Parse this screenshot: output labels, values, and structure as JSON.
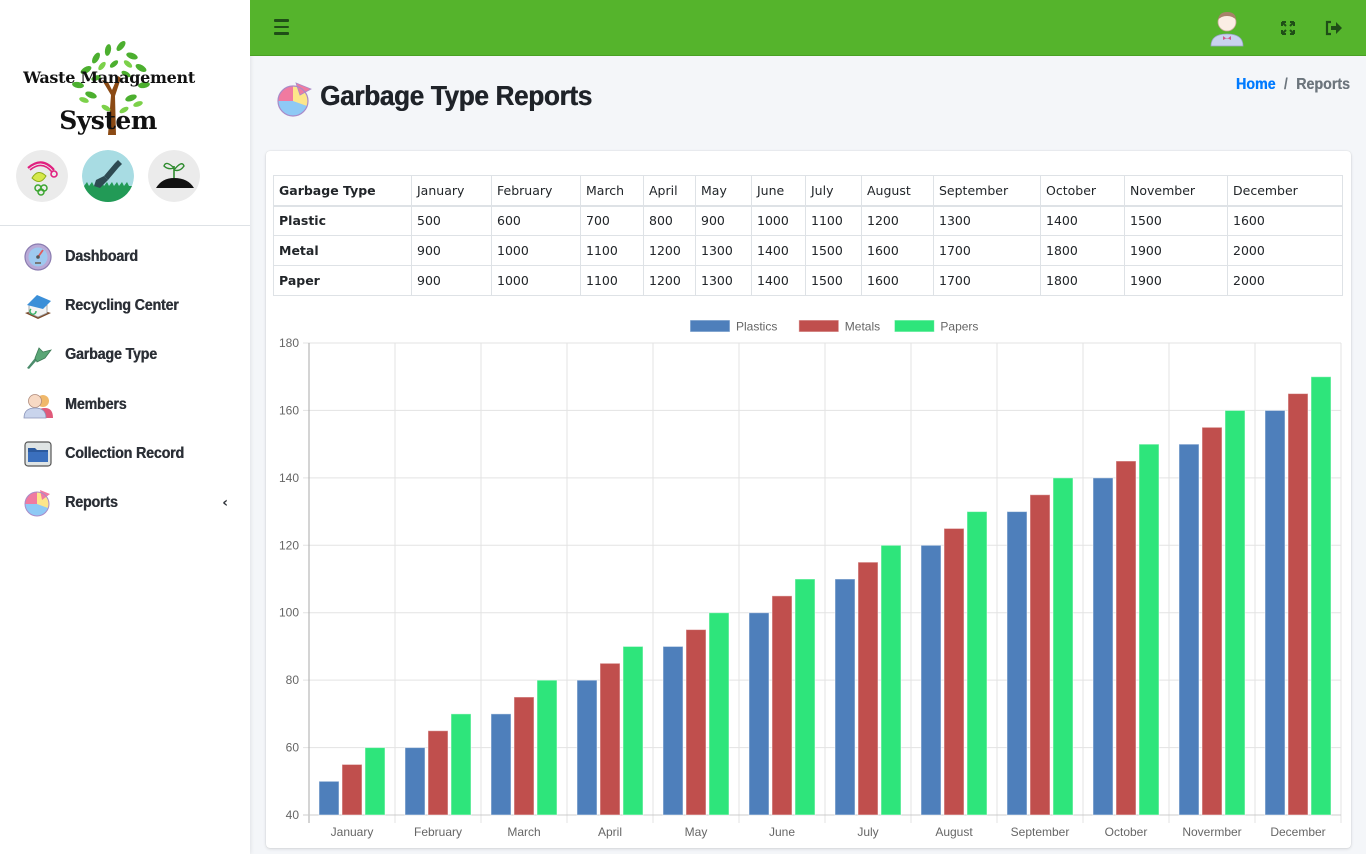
{
  "app": {
    "brand_line1": "Waste Management",
    "brand_line2": "System",
    "brand_badges": [
      "recycle-leaf-badge",
      "shovel-badge",
      "sprout-soil-badge"
    ]
  },
  "sidebar": {
    "items": [
      {
        "label": "Dashboard",
        "icon": "dashboard-gauge-icon"
      },
      {
        "label": "Recycling Center",
        "icon": "recycling-center-icon"
      },
      {
        "label": "Garbage Type",
        "icon": "garbage-type-icon"
      },
      {
        "label": "Members",
        "icon": "members-icon"
      },
      {
        "label": "Collection Record",
        "icon": "folder-icon"
      },
      {
        "label": "Reports",
        "icon": "pie-chart-icon",
        "arrow": "‹"
      }
    ]
  },
  "topbar": {
    "menu_icon": "hamburger-icon",
    "avatar_icon": "user-avatar-icon",
    "fullscreen_icon": "expand-icon",
    "logout_icon": "sign-out-icon",
    "bg_color": "#55b42c"
  },
  "header": {
    "title": "Garbage Type Reports",
    "breadcrumb": {
      "home": "Home",
      "separator": "/",
      "current": "Reports"
    }
  },
  "table": {
    "headers": [
      "Garbage Type",
      "January",
      "February",
      "March",
      "April",
      "May",
      "June",
      "July",
      "August",
      "September",
      "October",
      "November",
      "December"
    ],
    "rows": [
      {
        "type": "Plastic",
        "values": [
          "500",
          "600",
          "700",
          "800",
          "900",
          "1000",
          "1100",
          "1200",
          "1300",
          "1400",
          "1500",
          "1600"
        ]
      },
      {
        "type": "Metal",
        "values": [
          "900",
          "1000",
          "1100",
          "1200",
          "1300",
          "1400",
          "1500",
          "1600",
          "1700",
          "1800",
          "1900",
          "2000"
        ]
      },
      {
        "type": "Paper",
        "values": [
          "900",
          "1000",
          "1100",
          "1200",
          "1300",
          "1400",
          "1500",
          "1600",
          "1700",
          "1800",
          "1900",
          "2000"
        ]
      }
    ]
  },
  "chart_data": {
    "type": "bar",
    "title": "",
    "xlabel": "",
    "ylabel": "",
    "categories": [
      "January",
      "February",
      "March",
      "April",
      "May",
      "June",
      "July",
      "August",
      "September",
      "October",
      "Novermber",
      "December"
    ],
    "series": [
      {
        "name": "Plastics",
        "color": "#4e7fbb",
        "values": [
          50,
          60,
          70,
          80,
          90,
          100,
          110,
          120,
          130,
          140,
          150,
          160
        ]
      },
      {
        "name": "Metals",
        "color": "#c04f4d",
        "values": [
          55,
          65,
          75,
          85,
          95,
          105,
          115,
          125,
          135,
          145,
          155,
          165
        ]
      },
      {
        "name": "Papers",
        "color": "#2ee57b",
        "values": [
          60,
          70,
          80,
          90,
          100,
          110,
          120,
          130,
          140,
          150,
          160,
          170
        ]
      }
    ],
    "ylim": [
      40,
      180
    ],
    "yticks": [
      40,
      60,
      80,
      100,
      120,
      140,
      160,
      180
    ],
    "grid": true,
    "legend": "top-center"
  }
}
